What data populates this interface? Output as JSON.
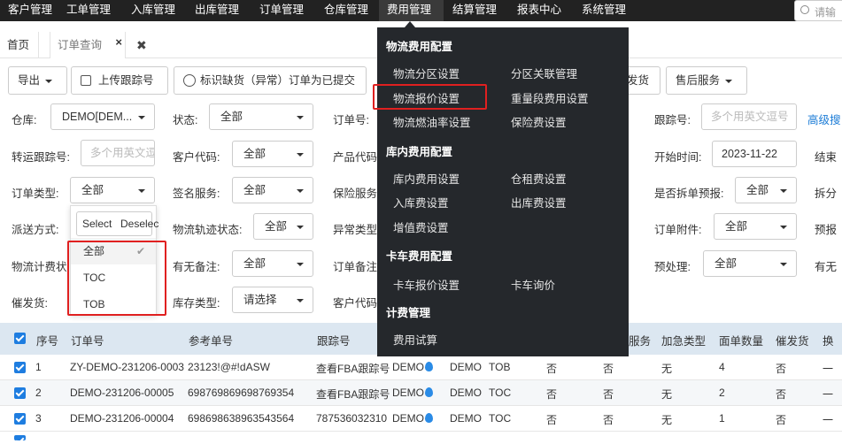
{
  "nav": {
    "items": [
      "客户管理",
      "工单管理",
      "入库管理",
      "出库管理",
      "订单管理",
      "仓库管理",
      "费用管理",
      "结算管理",
      "报表中心",
      "系统管理"
    ],
    "search_placeholder": "请输"
  },
  "tabs": {
    "home": "首页",
    "order": "订单查询",
    "close": "×",
    "close_all": "✖"
  },
  "toolbar": {
    "export": "导出",
    "upload_tracking": "上传跟踪号",
    "mark_missing": "标识缺货（异常）订单为已提交",
    "send_goods": "发货",
    "after_sales": "售后服务"
  },
  "filters": {
    "warehouse_label": "仓库:",
    "warehouse_value": "DEMO[DEM...",
    "status_label": "状态:",
    "status_value": "全部",
    "order_no_label": "订单号:",
    "tracking_label": "跟踪号:",
    "tracking_placeholder": "多个用英文逗号",
    "advanced_search": "高级搜",
    "transfer_tracking_label": "转运跟踪号:",
    "transfer_tracking_placeholder": "多个用英文逗",
    "customer_code_label": "客户代码:",
    "customer_code_value": "全部",
    "product_code_label": "产品代码",
    "start_time_label": "开始时间:",
    "start_time_value": "2023-11-22",
    "end_label": "结束",
    "order_type_label": "订单类型:",
    "order_type_value": "全部",
    "sign_service_label": "签名服务:",
    "sign_service_value": "全部",
    "insurance_label": "保险服务",
    "split_forecast_label": "是否拆单预报:",
    "split_forecast_value": "全部",
    "unpacking_label": "拆分",
    "dispatch_label": "派送方式:",
    "tracking_status_label": "物流轨迹状态:",
    "tracking_status_value": "全部",
    "exception_type_label": "异常类型",
    "order_attachment_label": "订单附件:",
    "order_attachment_value": "全部",
    "forecast_label": "预报",
    "logistics_billing_label": "物流计费状",
    "remark_label": "有无备注:",
    "remark_value": "全部",
    "order_remark_label": "订单备注",
    "preprocess_label": "预处理:",
    "preprocess_value": "全部",
    "has_label": "有无",
    "urge_label": "催发货:",
    "stock_type_label": "库存类型:",
    "stock_type_value": "请选择",
    "customer_code2_label": "客户代码"
  },
  "order_type_dropdown": {
    "select_all": "Select",
    "deselect": "Deselec",
    "options": [
      {
        "label": "全部",
        "selected": true
      },
      {
        "label": "TOC",
        "selected": false
      },
      {
        "label": "TOB",
        "selected": false
      }
    ]
  },
  "mega_menu": {
    "sections": [
      {
        "title": "物流费用配置",
        "items": [
          "物流分区设置",
          "分区关联管理",
          "物流报价设置",
          "重量段费用设置",
          "物流燃油率设置",
          "保险费设置"
        ]
      },
      {
        "title": "库内费用配置",
        "items": [
          "库内费用设置",
          "仓租费设置",
          "入库费设置",
          "出库费设置",
          "增值费设置"
        ]
      },
      {
        "title": "卡车费用配置",
        "items": [
          "卡车报价设置",
          "卡车询价"
        ]
      },
      {
        "title": "计费管理",
        "items": [
          "费用试算"
        ]
      }
    ]
  },
  "table": {
    "headers": [
      "序号",
      "订单号",
      "参考单号",
      "跟踪号",
      "服务",
      "加急类型",
      "面单数量",
      "催发货",
      "换"
    ],
    "rows": [
      {
        "index": "1",
        "order_no": "ZY-DEMO-231206-0003",
        "ref_no": "23123!@#!dASW",
        "tracking": "查看FBA跟踪号",
        "warehouse": "DEMO",
        "code": "DEMO",
        "type": "TOB",
        "c1": "否",
        "c2": "否",
        "urgent": "无",
        "labels": "4",
        "urge": "否",
        "swap": "一"
      },
      {
        "index": "2",
        "order_no": "DEMO-231206-00005",
        "ref_no": "698769869698769354",
        "tracking": "查看FBA跟踪号",
        "warehouse": "DEMO",
        "code": "DEMO",
        "type": "TOC",
        "c1": "否",
        "c2": "否",
        "urgent": "无",
        "labels": "2",
        "urge": "否",
        "swap": "一"
      },
      {
        "index": "3",
        "order_no": "DEMO-231206-00004",
        "ref_no": "698698638963543564",
        "tracking": "787536032310",
        "warehouse": "DEMO",
        "code": "DEMO",
        "type": "TOC",
        "c1": "否",
        "c2": "否",
        "urgent": "无",
        "labels": "1",
        "urge": "否",
        "swap": "一"
      }
    ]
  },
  "colors": {
    "nav_bg": "#222222",
    "menu_bg": "#25282c",
    "highlight_red": "#e02020",
    "link_blue": "#1a7bd6",
    "header_bg": "#dce7f1"
  }
}
